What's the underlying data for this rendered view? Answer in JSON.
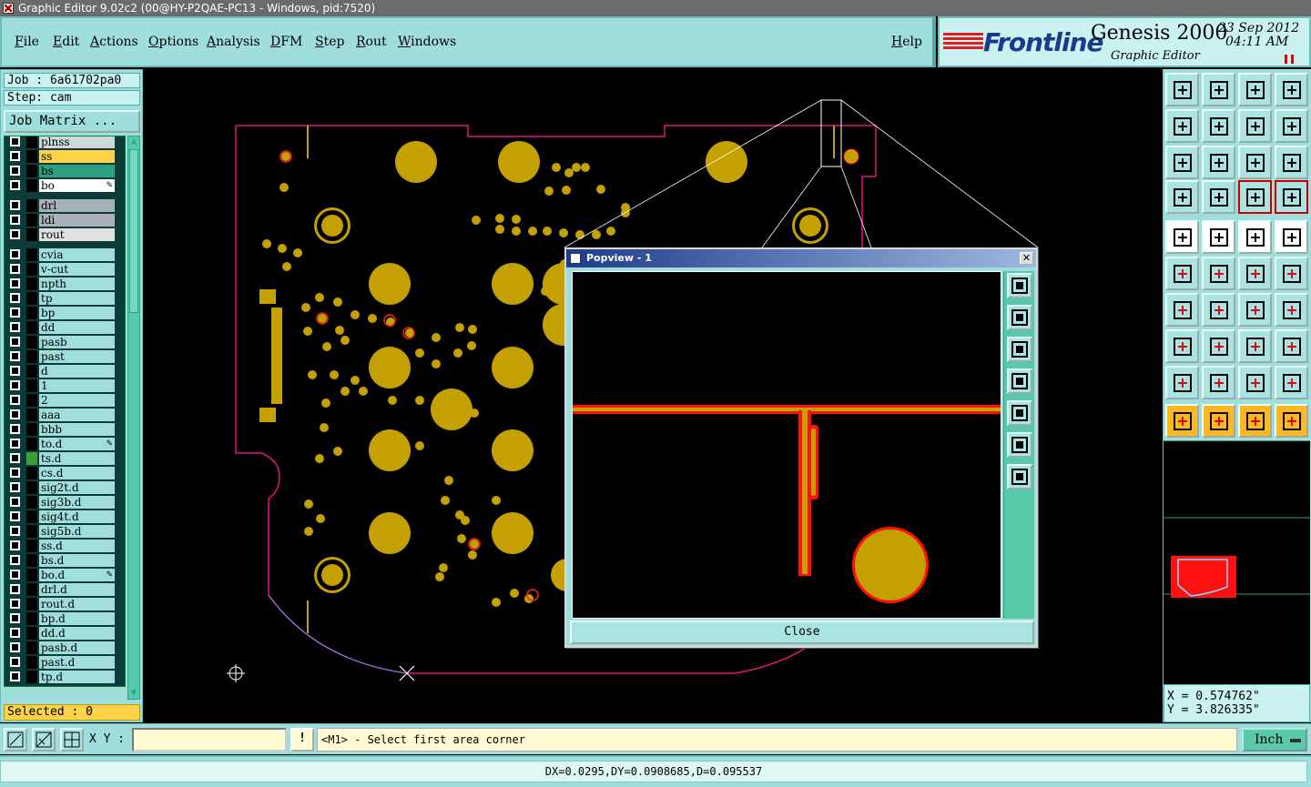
{
  "window": {
    "title": "Graphic Editor 9.02c2 (00@HY-P2QAE-PC13 - Windows, pid:7520)"
  },
  "menu": {
    "file": "File",
    "edit": "Edit",
    "actions": "Actions",
    "options": "Options",
    "analysis": "Analysis",
    "dfm": "DFM",
    "step": "Step",
    "rout": "Rout",
    "windows": "Windows",
    "help": "Help"
  },
  "brand": {
    "logo": "Frontline",
    "product": "Genesis 2000",
    "subtitle": "Graphic Editor",
    "date": "23 Sep 2012",
    "time": "04:11 AM"
  },
  "job": {
    "job_line": "Job : 6a61702pa0",
    "step_line": "Step: cam",
    "matrix_button": "Job Matrix ..."
  },
  "layers": [
    {
      "name": "plnss",
      "color": "#cfd8d8",
      "mark": "#000000"
    },
    {
      "name": "ss",
      "color": "#ffd24a",
      "mark": "#000000"
    },
    {
      "name": "bs",
      "color": "#2ea080",
      "mark": "#000000"
    },
    {
      "name": "bo",
      "color": "#ffffff",
      "mark": "#000000",
      "edit": true
    },
    {
      "name": "drl",
      "color": "#a8b0b8",
      "mark": "#000000"
    },
    {
      "name": "ldi",
      "color": "#a8b0b8",
      "mark": "#000000"
    },
    {
      "name": "rout",
      "color": "#e0e0e0",
      "mark": "#000000"
    },
    {
      "name": "cvia",
      "color": "#9fdedd",
      "mark": "#000000"
    },
    {
      "name": "v-cut",
      "color": "#9fdedd",
      "mark": "#000000"
    },
    {
      "name": "npth",
      "color": "#9fdedd",
      "mark": "#000000"
    },
    {
      "name": "tp",
      "color": "#9fdedd",
      "mark": "#000000"
    },
    {
      "name": "bp",
      "color": "#9fdedd",
      "mark": "#000000"
    },
    {
      "name": "dd",
      "color": "#9fdedd",
      "mark": "#000000"
    },
    {
      "name": "pasb",
      "color": "#9fdedd",
      "mark": "#000000"
    },
    {
      "name": "past",
      "color": "#9fdedd",
      "mark": "#000000"
    },
    {
      "name": "d",
      "color": "#9fdedd",
      "mark": "#000000"
    },
    {
      "name": "1",
      "color": "#9fdedd",
      "mark": "#000000"
    },
    {
      "name": "2",
      "color": "#9fdedd",
      "mark": "#000000"
    },
    {
      "name": "aaa",
      "color": "#9fdedd",
      "mark": "#000000"
    },
    {
      "name": "bbb",
      "color": "#9fdedd",
      "mark": "#000000"
    },
    {
      "name": "to.d",
      "color": "#9fdedd",
      "mark": "#000000",
      "edit": true
    },
    {
      "name": "ts.d",
      "color": "#9fdedd",
      "mark": "#3aa030"
    },
    {
      "name": "cs.d",
      "color": "#9fdedd",
      "mark": "#000000"
    },
    {
      "name": "sig2t.d",
      "color": "#9fdedd",
      "mark": "#000000"
    },
    {
      "name": "sig3b.d",
      "color": "#9fdedd",
      "mark": "#000000"
    },
    {
      "name": "sig4t.d",
      "color": "#9fdedd",
      "mark": "#000000"
    },
    {
      "name": "sig5b.d",
      "color": "#9fdedd",
      "mark": "#000000"
    },
    {
      "name": "ss.d",
      "color": "#9fdedd",
      "mark": "#000000"
    },
    {
      "name": "bs.d",
      "color": "#9fdedd",
      "mark": "#000000"
    },
    {
      "name": "bo.d",
      "color": "#9fdedd",
      "mark": "#000000",
      "edit": true
    },
    {
      "name": "drl.d",
      "color": "#9fdedd",
      "mark": "#000000"
    },
    {
      "name": "rout.d",
      "color": "#9fdedd",
      "mark": "#000000"
    },
    {
      "name": "bp.d",
      "color": "#9fdedd",
      "mark": "#000000"
    },
    {
      "name": "dd.d",
      "color": "#9fdedd",
      "mark": "#000000"
    },
    {
      "name": "pasb.d",
      "color": "#9fdedd",
      "mark": "#000000"
    },
    {
      "name": "past.d",
      "color": "#9fdedd",
      "mark": "#000000"
    },
    {
      "name": "tp.d",
      "color": "#9fdedd",
      "mark": "#000000"
    }
  ],
  "selected": "Selected : 0",
  "popview": {
    "title": "Popview - 1",
    "close_label": "Close",
    "close_x": "✕"
  },
  "coords": {
    "x": "X = 0.574762\"",
    "y": "Y = 3.826335\""
  },
  "status": {
    "xy_label": "X Y :",
    "xy_value": "",
    "warn": "!",
    "prompt": "<M1> - Select first area corner",
    "unit": "Inch",
    "measure": "DX=0.0295,DY=0.0908685,D=0.095537"
  },
  "colors": {
    "pad": "#c4a000",
    "outline": "#e0147a",
    "trace": "#ff2020",
    "panel": "#9fdedd"
  }
}
